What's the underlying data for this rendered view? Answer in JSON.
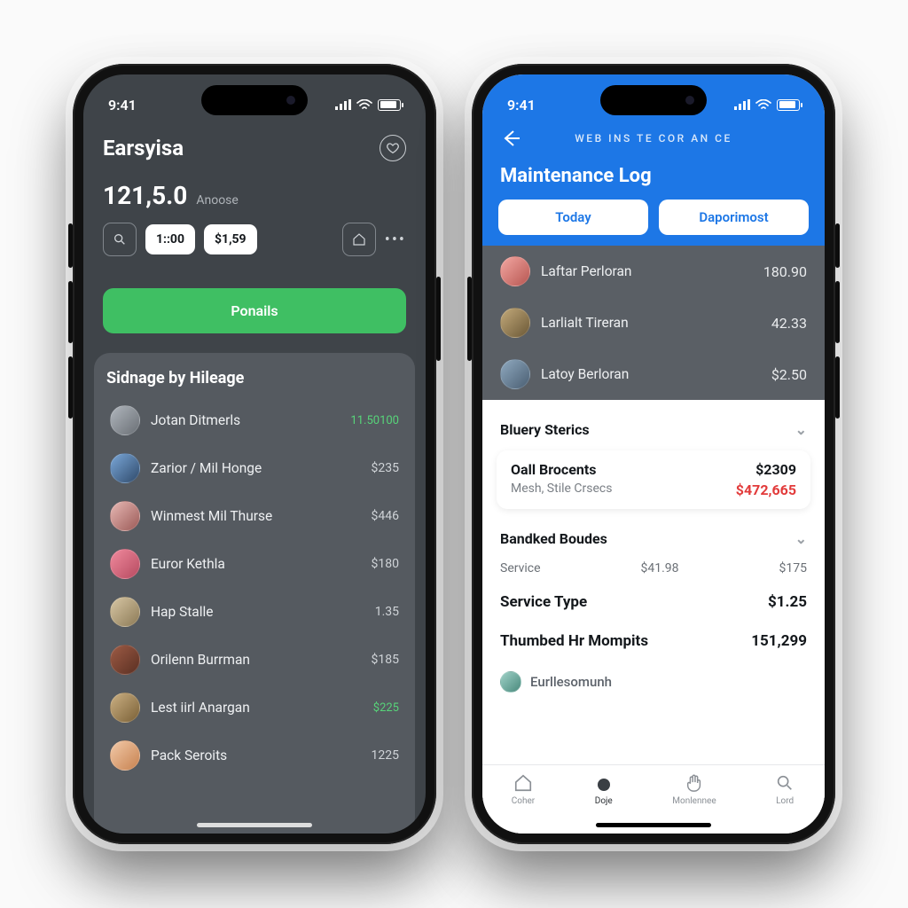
{
  "status_time": "9:41",
  "left": {
    "app_title": "Earsyisa",
    "amount": "121,5.0",
    "amount_label": "Anoose",
    "chip1": "1::00",
    "chip2": "$1,59",
    "primary_button": "Ponails",
    "section_title": "Sidnage by Hileage",
    "rows": [
      {
        "name": "Jotan Ditmerls",
        "value": "11.50100",
        "green": true
      },
      {
        "name": "Zarior / Mil Honge",
        "value": "$235"
      },
      {
        "name": "Winmest Mil Thurse",
        "value": "$446"
      },
      {
        "name": "Euror Kethla",
        "value": "$180"
      },
      {
        "name": "Hap Stalle",
        "value": "1.35"
      },
      {
        "name": "Orilenn Burrman",
        "value": "$185"
      },
      {
        "name": "Lest iirl Anargan",
        "value": "$225",
        "green": true
      },
      {
        "name": "Pack Seroits",
        "value": "1225"
      }
    ]
  },
  "right": {
    "breadcrumb": "WEB INS TE COR AN CE",
    "title": "Maintenance Log",
    "pill_today": "Today",
    "pill_other": "Daporimost",
    "top_rows": [
      {
        "name": "Laftar Perloran",
        "value": "180.90"
      },
      {
        "name": "Larlialt Tireran",
        "value": "42.33"
      },
      {
        "name": "Latoy Berloran",
        "value": "$2.50"
      }
    ],
    "section1": "Bluery Sterics",
    "card_title": "Oall Brocents",
    "card_value": "$2309",
    "card_sub": "Mesh, Stile Crsecs",
    "card_sub_value": "$472,665",
    "section2": "Bandked Boudes",
    "tri_label": "Service",
    "tri_v1": "$41.98",
    "tri_v2": "$175",
    "row_service_type": "Service Type",
    "row_service_type_v": "$1.25",
    "row_thumbed": "Thumbed Hr Mompits",
    "row_thumbed_v": "151,299",
    "row_last": "Eurllesomunh",
    "tabs": {
      "t1": "Coher",
      "t2": "Doje",
      "t3": "Monlennee",
      "t4": "Lord"
    }
  }
}
